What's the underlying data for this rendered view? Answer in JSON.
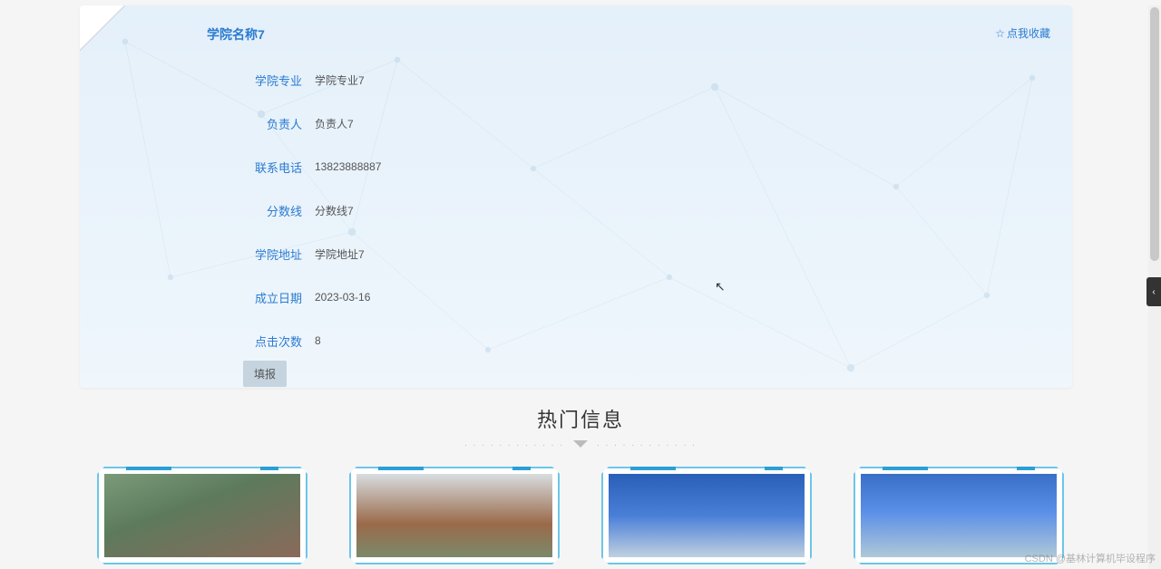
{
  "card": {
    "title": "学院名称7",
    "favorite_label": "点我收藏",
    "fields": [
      {
        "label": "学院专业",
        "value": "学院专业7"
      },
      {
        "label": "负责人",
        "value": "负责人7"
      },
      {
        "label": "联系电话",
        "value": "13823888887"
      },
      {
        "label": "分数线",
        "value": "分数线7"
      },
      {
        "label": "学院地址",
        "value": "学院地址7"
      },
      {
        "label": "成立日期",
        "value": "2023-03-16"
      },
      {
        "label": "点击次数",
        "value": "8"
      }
    ],
    "fill_button": "填报"
  },
  "hot": {
    "title": "热门信息",
    "dots": ". . . . . . . . . . . .",
    "cards": [
      {
        "alt": "校园1"
      },
      {
        "alt": "校园2"
      },
      {
        "alt": "校园3"
      },
      {
        "alt": "校园4"
      }
    ]
  },
  "side_tab": "‹",
  "watermark": "CSDN @基林计算机毕设程序"
}
